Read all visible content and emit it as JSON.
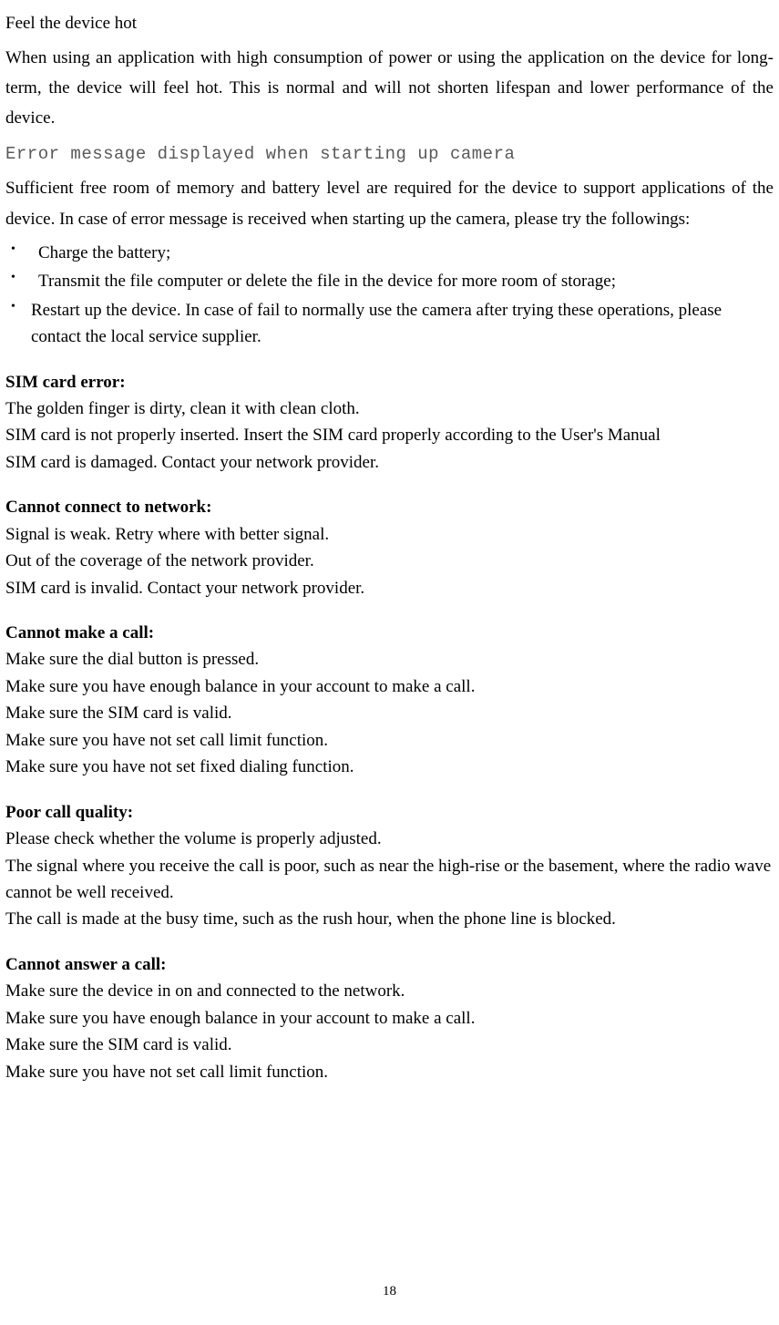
{
  "headings": {
    "feel_hot": "Feel the device hot",
    "camera_error": "Error message displayed when starting up camera"
  },
  "paragraphs": {
    "feel_hot_body": "When using an application with high consumption of power or using the application on the device for long-term, the device will feel hot. This is normal and will not shorten lifespan and lower performance of the device.",
    "camera_body": "Sufficient free room of memory and battery level are required for the device to support applications of the device. In case of error message is received when starting up the camera, please try the followings:"
  },
  "bullets": [
    " Charge the battery;",
    " Transmit the file computer or delete the file in the device for more room of storage;",
    "Restart up the device. In case of fail to normally use the camera after trying these operations, please contact the local service supplier."
  ],
  "sections": [
    {
      "title": "SIM card error:",
      "lines": [
        "The golden finger is dirty, clean it with clean cloth.",
        "SIM card is not properly inserted. Insert the SIM card properly according to the User's Manual",
        "SIM card is damaged. Contact your network provider."
      ]
    },
    {
      "title": "Cannot connect to network:",
      "lines": [
        "Signal is weak. Retry where with better signal.",
        "Out of the coverage of the network provider.",
        "SIM card is invalid. Contact your network provider."
      ]
    },
    {
      "title": "Cannot make a call:",
      "lines": [
        "Make sure the dial button is pressed.",
        "Make sure you have enough balance in your account to make a call.",
        "Make sure the SIM card is valid.",
        "Make sure you have not set call limit function.",
        "Make sure you have not set fixed dialing function."
      ]
    },
    {
      "title": "Poor call quality:",
      "lines": [
        "Please check whether the volume is properly adjusted.",
        "The signal where you receive the call is poor, such as near the high-rise or the basement, where the radio wave cannot be well received.",
        "The call is made at the busy time, such as the rush hour, when the phone line is blocked."
      ]
    },
    {
      "title": "Cannot answer a call:",
      "lines": [
        "Make sure the device in on and connected to the network.",
        "Make sure you have enough balance in your account to make a call.",
        "Make sure the SIM card is valid.",
        "Make sure you have not set call limit function."
      ]
    }
  ],
  "page_number": "18"
}
